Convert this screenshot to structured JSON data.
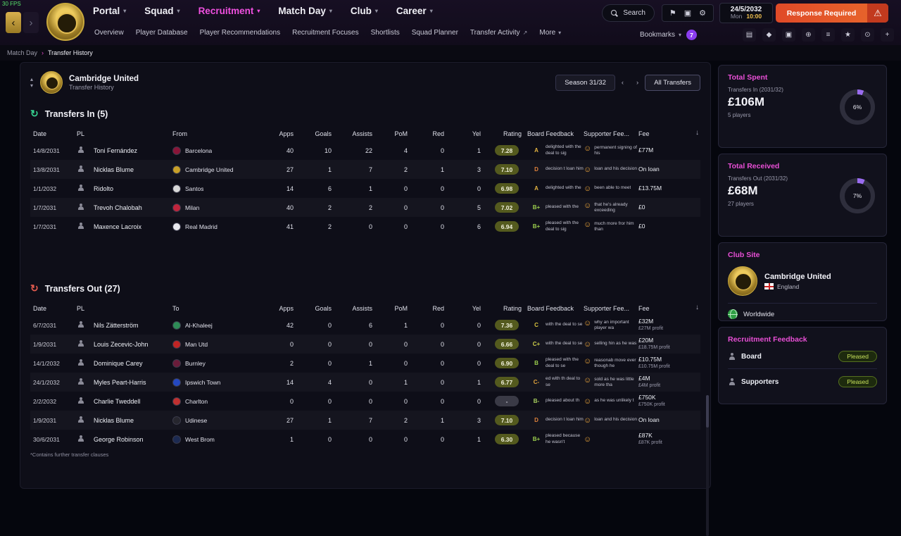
{
  "fps_label": "30 FPS",
  "accent": {
    "pink": "#e94fd6",
    "purple": "#9a6cf0",
    "ring": "#2e2e3c"
  },
  "icons": {
    "back": "‹",
    "forward": "›",
    "chevron_down": "▾",
    "chevron_up": "▴",
    "sort": "↓",
    "gear": "⚙",
    "bookmark": "⚑",
    "monitor": "▣",
    "warning": "⚠",
    "refresh": "↻",
    "external": "↗",
    "smiley": "☺",
    "breadcrumb_sep": "›"
  },
  "topbar": {
    "menus": [
      {
        "label": "Portal",
        "active": false
      },
      {
        "label": "Squad",
        "active": false
      },
      {
        "label": "Recruitment",
        "active": true
      },
      {
        "label": "Match Day",
        "active": false
      },
      {
        "label": "Club",
        "active": false
      },
      {
        "label": "Career",
        "active": false
      }
    ],
    "search_label": "Search",
    "date": "24/5/2032",
    "day": "Mon",
    "time": "10:00",
    "alert_label": "Response Required",
    "notification_count": "7",
    "toolbar_icons": [
      {
        "name": "inbox-icon",
        "glyph": "▤"
      },
      {
        "name": "club-icon",
        "glyph": "◆"
      },
      {
        "name": "squad-icon",
        "glyph": "▣"
      },
      {
        "name": "tactics-icon",
        "glyph": "⊕"
      },
      {
        "name": "schedule-icon",
        "glyph": "≡"
      },
      {
        "name": "competition-icon",
        "glyph": "★"
      },
      {
        "name": "training-icon",
        "glyph": "⊙"
      },
      {
        "name": "medical-icon",
        "glyph": "+"
      }
    ]
  },
  "subnav": {
    "items": [
      {
        "label": "Overview",
        "external": false,
        "chevron": false
      },
      {
        "label": "Player Database",
        "external": false,
        "chevron": false
      },
      {
        "label": "Player Recommendations",
        "external": false,
        "chevron": false
      },
      {
        "label": "Recruitment Focuses",
        "external": false,
        "chevron": false
      },
      {
        "label": "Shortlists",
        "external": false,
        "chevron": false
      },
      {
        "label": "Squad Planner",
        "external": false,
        "chevron": false
      },
      {
        "label": "Transfer Activity",
        "external": true,
        "chevron": false
      },
      {
        "label": "More",
        "external": false,
        "chevron": true
      }
    ],
    "bookmarks_label": "Bookmarks"
  },
  "breadcrumb": {
    "items": [
      "Match Day",
      "Transfer History"
    ]
  },
  "panel": {
    "club_name": "Cambridge United",
    "subtitle": "Transfer History",
    "season_label": "Season 31/32",
    "filter_label": "All Transfers",
    "footnote": "*Contains further transfer clauses"
  },
  "transfers_in": {
    "title": "Transfers In (5)",
    "columns": {
      "date": "Date",
      "pl": "PL",
      "club": "From",
      "apps": "Apps",
      "goals": "Goals",
      "assists": "Assists",
      "pom": "PoM",
      "red": "Red",
      "yel": "Yel",
      "rating": "Rating",
      "board": "Board Feedback",
      "supporter": "Supporter Fee...",
      "fee": "Fee"
    },
    "rows": [
      {
        "date": "14/8/2031",
        "player": "Toni Fernández",
        "club": "Barcelona",
        "club_color": "#8a1538",
        "apps": "40",
        "goals": "10",
        "assists": "22",
        "pom": "4",
        "red": "0",
        "yel": "1",
        "rating": "7.28",
        "grade": "A",
        "grade_color": "#e3b341",
        "board_text": "delighted with the deal to sig",
        "supporter_text": "permanent signing of his",
        "fee": "£77M",
        "fee_sub": ""
      },
      {
        "date": "13/8/2031",
        "player": "Nicklas Blume",
        "club": "Cambridge United",
        "club_color": "#c8a028",
        "apps": "27",
        "goals": "1",
        "assists": "7",
        "pom": "2",
        "red": "1",
        "yel": "3",
        "rating": "7.10",
        "grade": "D",
        "grade_color": "#e0823c",
        "board_text": "decision t loan him",
        "supporter_text": "loan and his decision",
        "fee": "On loan",
        "fee_sub": ""
      },
      {
        "date": "1/1/2032",
        "player": "Ridolto",
        "club": "Santos",
        "club_color": "#d8d8d8",
        "apps": "14",
        "goals": "6",
        "assists": "1",
        "pom": "0",
        "red": "0",
        "yel": "0",
        "rating": "6.98",
        "grade": "A",
        "grade_color": "#e3b341",
        "board_text": "delighted with the",
        "supporter_text": "been able to meet",
        "fee": "£13.75M",
        "fee_sub": ""
      },
      {
        "date": "1/7/2031",
        "player": "Trevoh Chalobah",
        "club": "Milan",
        "club_color": "#c0243c",
        "apps": "40",
        "goals": "2",
        "assists": "2",
        "pom": "0",
        "red": "0",
        "yel": "5",
        "rating": "7.02",
        "grade": "B+",
        "grade_color": "#9ccf4e",
        "board_text": "pleased with the",
        "supporter_text": "that he's already exceeding",
        "fee": "£0",
        "fee_sub": ""
      },
      {
        "date": "1/7/2031",
        "player": "Maxence Lacroix",
        "club": "Real Madrid",
        "club_color": "#e8e8ee",
        "apps": "41",
        "goals": "2",
        "assists": "0",
        "pom": "0",
        "red": "0",
        "yel": "6",
        "rating": "6.94",
        "grade": "B+",
        "grade_color": "#9ccf4e",
        "board_text": "pleased with the deal to sig",
        "supporter_text": "much more fror him than",
        "fee": "£0",
        "fee_sub": ""
      }
    ]
  },
  "transfers_out": {
    "title": "Transfers Out (27)",
    "columns": {
      "date": "Date",
      "pl": "PL",
      "club": "To",
      "apps": "Apps",
      "goals": "Goals",
      "assists": "Assists",
      "pom": "PoM",
      "red": "Red",
      "yel": "Yel",
      "rating": "Rating",
      "board": "Board Feedback",
      "supporter": "Supporter Fee...",
      "fee": "Fee"
    },
    "rows": [
      {
        "date": "6/7/2031",
        "player": "Nils Zätterström",
        "club": "Al-Khaleej",
        "club_color": "#2e8b57",
        "apps": "42",
        "goals": "0",
        "assists": "6",
        "pom": "1",
        "red": "0",
        "yel": "0",
        "rating": "7.36",
        "grade": "C",
        "grade_color": "#d8c23e",
        "board_text": "with the deal to se",
        "supporter_text": "why an important player wa",
        "fee": "£32M",
        "fee_sub": "£27M profit"
      },
      {
        "date": "1/9/2031",
        "player": "Louis Zecevic-John",
        "club": "Man Utd",
        "club_color": "#c02424",
        "apps": "0",
        "goals": "0",
        "assists": "0",
        "pom": "0",
        "red": "0",
        "yel": "0",
        "rating": "6.66",
        "grade": "C+",
        "grade_color": "#cfd04a",
        "board_text": "with the deal to se",
        "supporter_text": "selling hin as he was",
        "fee": "£20M",
        "fee_sub": "£18.75M profit"
      },
      {
        "date": "14/1/2032",
        "player": "Dominique Carey",
        "club": "Burnley",
        "club_color": "#6a1c3a",
        "apps": "2",
        "goals": "0",
        "assists": "1",
        "pom": "0",
        "red": "0",
        "yel": "0",
        "rating": "6.90",
        "grade": "B",
        "grade_color": "#9ccf4e",
        "board_text": "pleased with the deal to se",
        "supporter_text": "reasonab move ever though he",
        "fee": "£10.75M",
        "fee_sub": "£10.75M profit"
      },
      {
        "date": "24/1/2032",
        "player": "Myles Peart-Harris",
        "club": "Ipswich Town",
        "club_color": "#2448c0",
        "apps": "14",
        "goals": "4",
        "assists": "0",
        "pom": "1",
        "red": "0",
        "yel": "1",
        "rating": "6.77",
        "grade": "C-",
        "grade_color": "#e0a23c",
        "board_text": "ed with th deal to se",
        "supporter_text": "sold as he was little more tha",
        "fee": "£4M",
        "fee_sub": "£4M profit"
      },
      {
        "date": "2/2/2032",
        "player": "Charlie Tweddell",
        "club": "Charlton",
        "club_color": "#c03030",
        "apps": "0",
        "goals": "0",
        "assists": "0",
        "pom": "0",
        "red": "0",
        "yel": "0",
        "rating": "-",
        "grade": "B-",
        "grade_color": "#a8cf5e",
        "board_text": "pleased about th",
        "supporter_text": "as he was unlikely t",
        "fee": "£750K",
        "fee_sub": "£750K profit"
      },
      {
        "date": "1/9/2031",
        "player": "Nicklas Blume",
        "club": "Udinese",
        "club_color": "#26262e",
        "apps": "27",
        "goals": "1",
        "assists": "7",
        "pom": "2",
        "red": "1",
        "yel": "3",
        "rating": "7.10",
        "grade": "D",
        "grade_color": "#e0823c",
        "board_text": "decision t loan him",
        "supporter_text": "loan and his decision",
        "fee": "On loan",
        "fee_sub": ""
      },
      {
        "date": "30/6/2031",
        "player": "George Robinson",
        "club": "West Brom",
        "club_color": "#1c2a52",
        "apps": "1",
        "goals": "0",
        "assists": "0",
        "pom": "0",
        "red": "0",
        "yel": "1",
        "rating": "6.30",
        "grade": "B+",
        "grade_color": "#9ccf4e",
        "board_text": "pleased because he wasn't",
        "supporter_text": "",
        "fee": "£87K",
        "fee_sub": "£87K profit"
      }
    ]
  },
  "sidebar": {
    "total_spent": {
      "title": "Total Spent",
      "subtitle": "Transfers In (2031/32)",
      "amount": "£106M",
      "players": "5 players",
      "percent": "6%",
      "percent_value": 6
    },
    "total_received": {
      "title": "Total Received",
      "subtitle": "Transfers Out (2031/32)",
      "amount": "£68M",
      "players": "27 players",
      "percent": "7%",
      "percent_value": 7
    },
    "club_site": {
      "title": "Club Site",
      "club": "Cambridge United",
      "country": "England",
      "scope": "Worldwide"
    },
    "recruitment_feedback": {
      "title": "Recruitment Feedback",
      "rows": [
        {
          "label": "Board",
          "status": "Pleased"
        },
        {
          "label": "Supporters",
          "status": "Pleased"
        }
      ]
    }
  }
}
